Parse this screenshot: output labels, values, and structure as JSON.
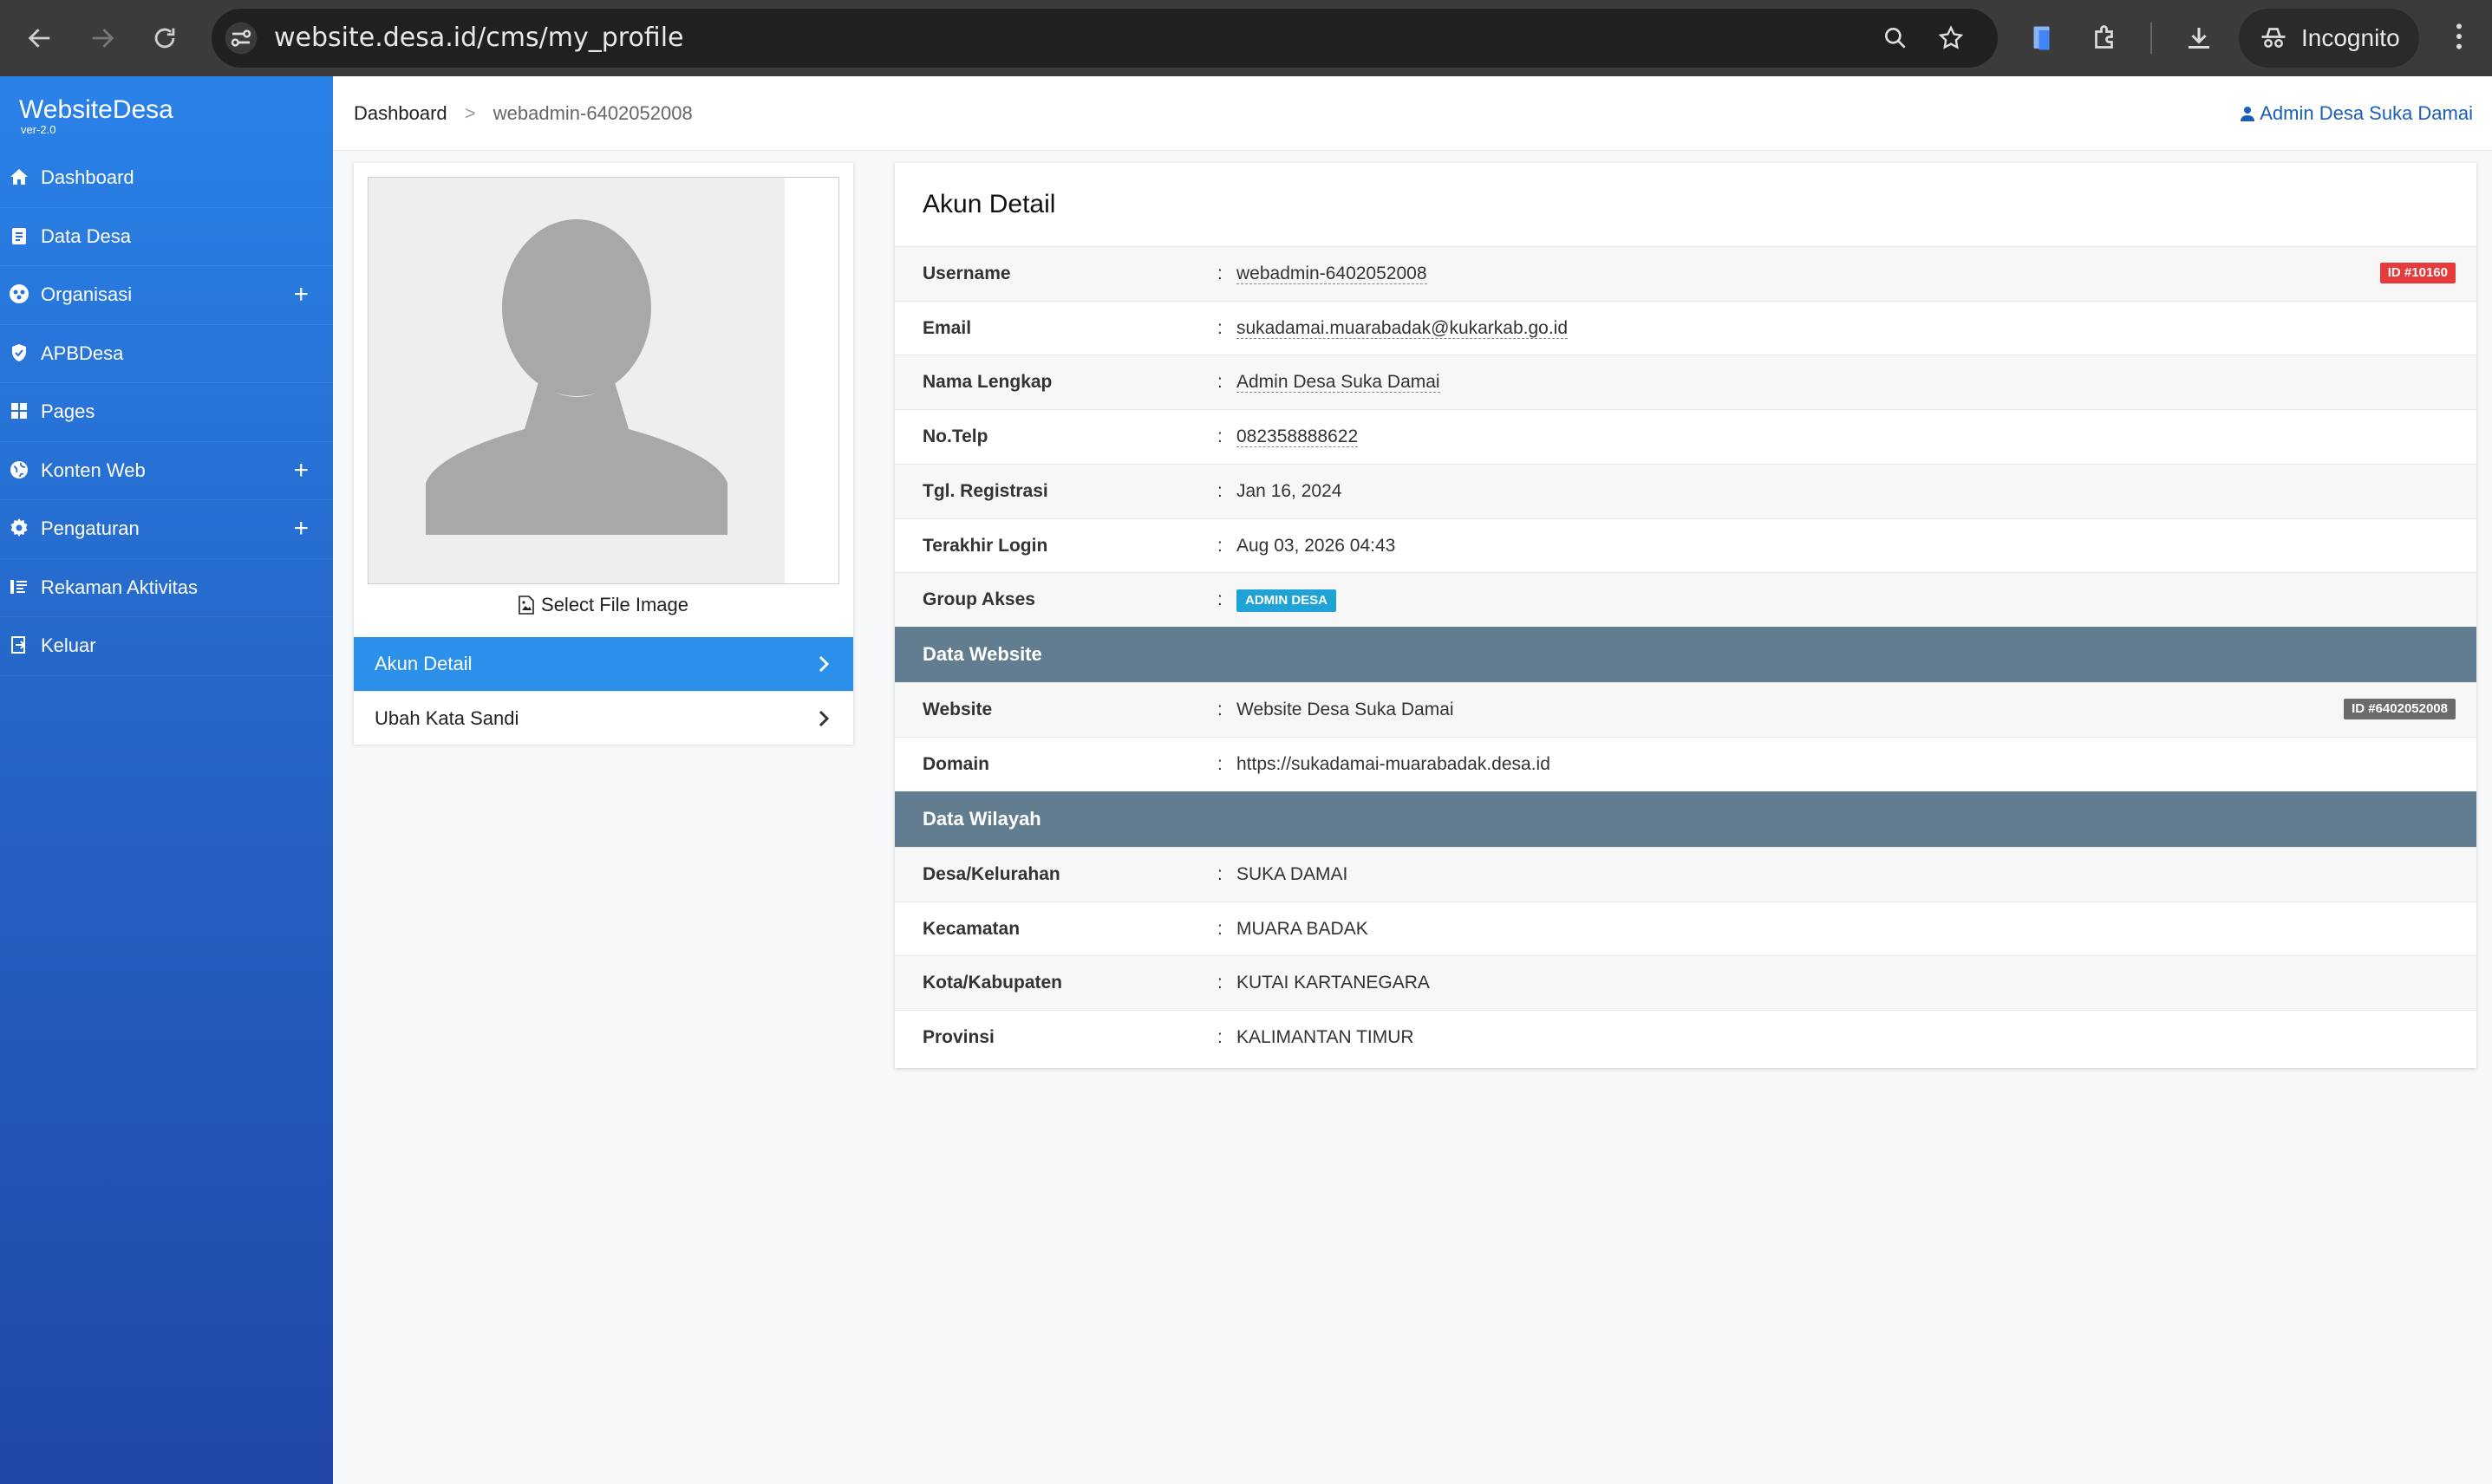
{
  "browser": {
    "url": "website.desa.id/cms/my_profile",
    "incognito_label": "Incognito"
  },
  "sidebar": {
    "brand": "WebsiteDesa",
    "version": "ver-2.0",
    "items": [
      {
        "label": "Dashboard",
        "icon": "home-icon",
        "expandable": false
      },
      {
        "label": "Data Desa",
        "icon": "clipboard-icon",
        "expandable": false
      },
      {
        "label": "Organisasi",
        "icon": "group-icon",
        "expandable": true
      },
      {
        "label": "APBDesa",
        "icon": "shield-icon",
        "expandable": false
      },
      {
        "label": "Pages",
        "icon": "pages-icon",
        "expandable": false
      },
      {
        "label": "Konten Web",
        "icon": "globe-icon",
        "expandable": true
      },
      {
        "label": "Pengaturan",
        "icon": "gear-icon",
        "expandable": true
      },
      {
        "label": "Rekaman Aktivitas",
        "icon": "activity-icon",
        "expandable": false
      },
      {
        "label": "Keluar",
        "icon": "logout-icon",
        "expandable": false
      }
    ],
    "plus_symbol": "+"
  },
  "topbar": {
    "breadcrumb": {
      "home": "Dashboard",
      "separator": ">",
      "current": "webadmin-6402052008"
    },
    "user": "Admin Desa Suka Damai"
  },
  "profile": {
    "select_image": "Select File Image",
    "menu": [
      {
        "label": "Akun Detail",
        "active": true
      },
      {
        "label": "Ubah Kata Sandi",
        "active": false
      }
    ]
  },
  "detail": {
    "title": "Akun Detail",
    "colon": ":",
    "account_rows": [
      {
        "label": "Username",
        "value": "webadmin-6402052008",
        "badge": "ID #10160"
      },
      {
        "label": "Email",
        "value": "sukadamai.muarabadak@kukarkab.go.id"
      },
      {
        "label": "Nama Lengkap",
        "value": "Admin Desa Suka Damai"
      },
      {
        "label": "No.Telp",
        "value": "082358888622"
      },
      {
        "label": "Tgl. Registrasi",
        "value": "Jan 16, 2024"
      },
      {
        "label": "Terakhir Login",
        "value": "Aug 03, 2026 04:43"
      },
      {
        "label": "Group Akses",
        "value": "ADMIN DESA"
      }
    ],
    "website_section": "Data Website",
    "website_rows": [
      {
        "label": "Website",
        "value": "Website Desa Suka Damai",
        "badge": "ID #6402052008"
      },
      {
        "label": "Domain",
        "value": "https://sukadamai-muarabadak.desa.id"
      }
    ],
    "wilayah_section": "Data Wilayah",
    "wilayah_rows": [
      {
        "label": "Desa/Kelurahan",
        "value": "SUKA DAMAI"
      },
      {
        "label": "Kecamatan",
        "value": "MUARA BADAK"
      },
      {
        "label": "Kota/Kabupaten",
        "value": "KUTAI KARTANEGARA"
      },
      {
        "label": "Provinsi",
        "value": "KALIMANTAN TIMUR"
      }
    ]
  },
  "colors": {
    "sidebar_top": "#2a82e8",
    "sidebar_bottom": "#2047a8",
    "active_menu": "#2b90ea",
    "section_header": "#617d8f",
    "badge_red": "#e63b3b",
    "badge_gray": "#6b6b6b",
    "badge_blue": "#1fa3d6",
    "link": "#1a5fb4"
  }
}
